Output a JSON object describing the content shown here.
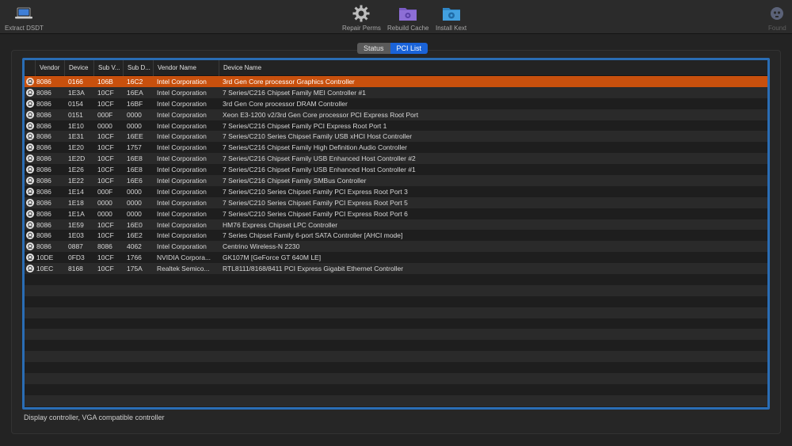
{
  "toolbar": {
    "left": [
      {
        "label": "Extract DSDT",
        "icon": "laptop-icon"
      }
    ],
    "center": [
      {
        "label": "Repair Perms",
        "icon": "gear-icon"
      },
      {
        "label": "Rebuild Cache",
        "icon": "purple-folder-gear-icon"
      },
      {
        "label": "Install Kext",
        "icon": "blue-folder-icon"
      }
    ],
    "right": [
      {
        "label": "Found",
        "icon": "skull-icon",
        "disabled": true
      }
    ]
  },
  "tabs": [
    {
      "label": "Status",
      "active": false
    },
    {
      "label": "PCI List",
      "active": true
    }
  ],
  "table": {
    "columns": [
      "",
      "Vendor",
      "Device",
      "Sub V...",
      "Sub D...",
      "Vendor Name",
      "Device Name"
    ],
    "selected_index": 0,
    "rows": [
      [
        "8086",
        "0166",
        "106B",
        "16C2",
        "Intel Corporation",
        "3rd Gen Core processor Graphics Controller"
      ],
      [
        "8086",
        "1E3A",
        "10CF",
        "16EA",
        "Intel Corporation",
        "7 Series/C216 Chipset Family MEI Controller #1"
      ],
      [
        "8086",
        "0154",
        "10CF",
        "16BF",
        "Intel Corporation",
        "3rd Gen Core processor DRAM Controller"
      ],
      [
        "8086",
        "0151",
        "000F",
        "0000",
        "Intel Corporation",
        "Xeon E3-1200 v2/3rd Gen Core processor PCI Express Root Port"
      ],
      [
        "8086",
        "1E10",
        "0000",
        "0000",
        "Intel Corporation",
        "7 Series/C216 Chipset Family PCI Express Root Port 1"
      ],
      [
        "8086",
        "1E31",
        "10CF",
        "16EE",
        "Intel Corporation",
        "7 Series/C210 Series Chipset Family USB xHCI Host Controller"
      ],
      [
        "8086",
        "1E20",
        "10CF",
        "1757",
        "Intel Corporation",
        "7 Series/C216 Chipset Family High Definition Audio Controller"
      ],
      [
        "8086",
        "1E2D",
        "10CF",
        "16E8",
        "Intel Corporation",
        "7 Series/C216 Chipset Family USB Enhanced Host Controller #2"
      ],
      [
        "8086",
        "1E26",
        "10CF",
        "16E8",
        "Intel Corporation",
        "7 Series/C216 Chipset Family USB Enhanced Host Controller #1"
      ],
      [
        "8086",
        "1E22",
        "10CF",
        "16E6",
        "Intel Corporation",
        "7 Series/C216 Chipset Family SMBus Controller"
      ],
      [
        "8086",
        "1E14",
        "000F",
        "0000",
        "Intel Corporation",
        "7 Series/C210 Series Chipset Family PCI Express Root Port 3"
      ],
      [
        "8086",
        "1E18",
        "0000",
        "0000",
        "Intel Corporation",
        "7 Series/C210 Series Chipset Family PCI Express Root Port 5"
      ],
      [
        "8086",
        "1E1A",
        "0000",
        "0000",
        "Intel Corporation",
        "7 Series/C210 Series Chipset Family PCI Express Root Port 6"
      ],
      [
        "8086",
        "1E59",
        "10CF",
        "16E0",
        "Intel Corporation",
        "HM76 Express Chipset LPC Controller"
      ],
      [
        "8086",
        "1E03",
        "10CF",
        "16E2",
        "Intel Corporation",
        "7 Series Chipset Family 6-port SATA Controller [AHCI mode]"
      ],
      [
        "8086",
        "0887",
        "8086",
        "4062",
        "Intel Corporation",
        "Centrino Wireless-N 2230"
      ],
      [
        "10DE",
        "0FD3",
        "10CF",
        "1766",
        "NVIDIA Corpora...",
        "GK107M [GeForce GT 640M LE]"
      ],
      [
        "10EC",
        "8168",
        "10CF",
        "175A",
        "Realtek Semico...",
        "RTL8111/8168/8411 PCI Express Gigabit Ethernet Controller"
      ]
    ]
  },
  "status_text": "Display controller, VGA compatible controller",
  "colors": {
    "selection": "#c8500d",
    "focus_ring": "#2a6db5",
    "tab_active": "#1a63d8"
  }
}
